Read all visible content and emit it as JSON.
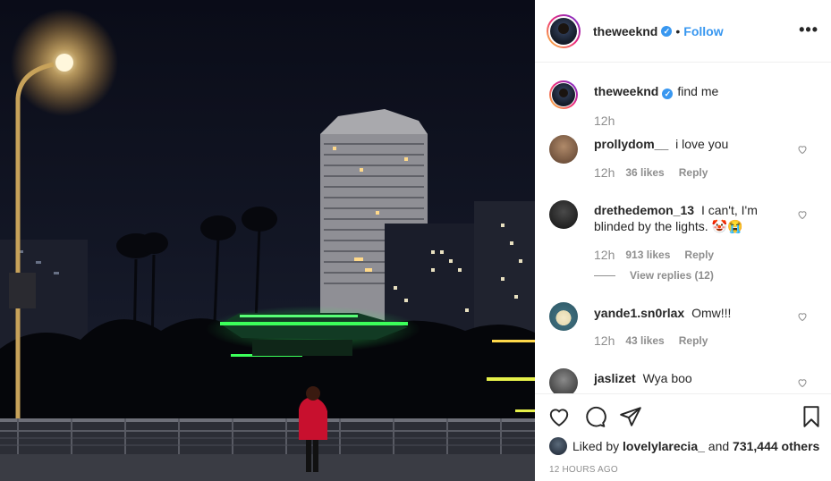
{
  "post": {
    "username": "theweeknd",
    "verified_glyph": "✓",
    "separator": "•",
    "follow_label": "Follow",
    "more_label": "•••",
    "caption": "find me",
    "caption_time": "12h"
  },
  "comments": [
    {
      "username": "prollydom__",
      "text": "i love you",
      "time": "12h",
      "likes": "36 likes",
      "reply": "Reply",
      "avatar": "avatar-brown"
    },
    {
      "username": "drethedemon_13",
      "text": "I can't, I'm blinded by the lights. 🤡😭",
      "time": "12h",
      "likes": "913 likes",
      "reply": "Reply",
      "view_replies": "View replies (12)",
      "avatar": "avatar-dark"
    },
    {
      "username": "yande1.sn0rlax",
      "text": "Omw!!!",
      "time": "12h",
      "likes": "43 likes",
      "reply": "Reply",
      "avatar": "avatar-snorlax"
    },
    {
      "username": "jaslizet",
      "text": "Wya boo",
      "avatar": "avatar-group"
    }
  ],
  "footer": {
    "liked_prefix": "Liked by",
    "liked_user": "lovelylarecia_",
    "liked_and": "and",
    "liked_count": "731,444 others",
    "posted_ago": "12 HOURS AGO"
  },
  "icons": [
    "heart-icon",
    "comment-icon",
    "share-icon",
    "bookmark-icon",
    "verified-icon",
    "more-icon"
  ],
  "colors": {
    "accent": "#3897f0",
    "muted": "#8e8e8e",
    "text": "#262626",
    "border": "#efefef"
  }
}
